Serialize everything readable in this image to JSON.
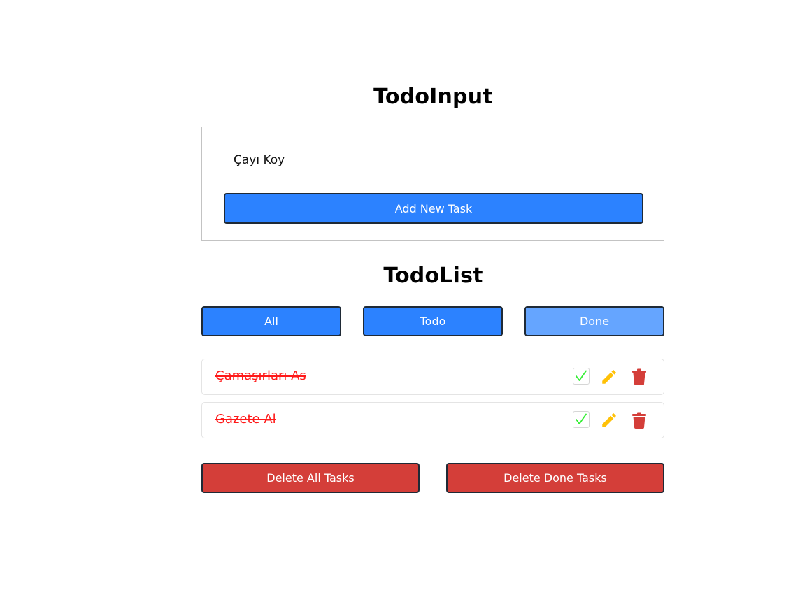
{
  "todo_input": {
    "title": "TodoInput",
    "input_value": "Çayı Koy",
    "add_button_label": "Add New Task"
  },
  "todo_list": {
    "title": "TodoList",
    "filters": [
      {
        "label": "All",
        "active": false
      },
      {
        "label": "Todo",
        "active": false
      },
      {
        "label": "Done",
        "active": true
      }
    ],
    "tasks": [
      {
        "text": "Çamaşırları As",
        "done": true
      },
      {
        "text": "Gazete Al",
        "done": true
      }
    ],
    "task_icons": [
      "check-icon",
      "pencil-icon",
      "trash-icon"
    ]
  },
  "actions": {
    "delete_all_label": "Delete All Tasks",
    "delete_done_label": "Delete Done Tasks"
  },
  "colors": {
    "primary": "#2c82ff",
    "primary_active": "#65a5ff",
    "danger": "#d43e39",
    "done_text": "#ff1a1a",
    "check": "#33ee33",
    "edit": "#ffc107"
  }
}
